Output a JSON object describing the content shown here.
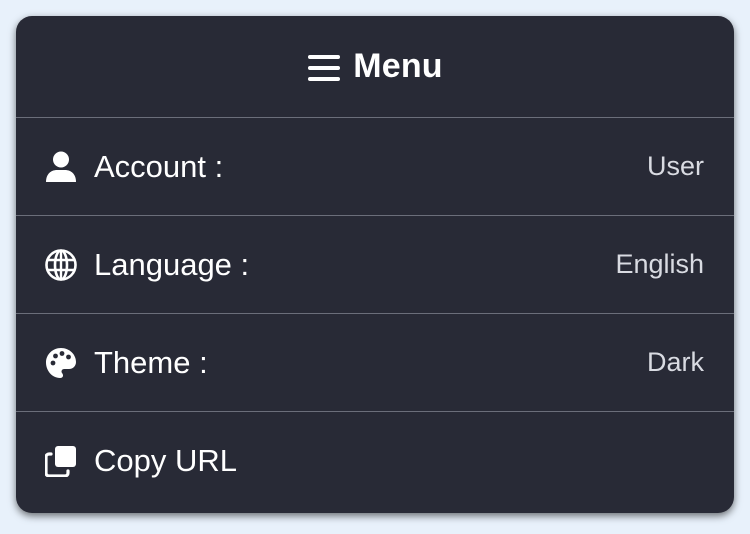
{
  "menu": {
    "title": "Menu",
    "header_icon": "hamburger-icon",
    "items": [
      {
        "icon": "user-icon",
        "label": "Account :",
        "value": "User"
      },
      {
        "icon": "globe-icon",
        "label": "Language :",
        "value": "English"
      },
      {
        "icon": "palette-icon",
        "label": "Theme :",
        "value": "Dark"
      },
      {
        "icon": "copy-icon",
        "label": "Copy URL"
      }
    ]
  },
  "colors": {
    "page_background": "#e8f1fb",
    "panel_background": "#282a36",
    "divider": "#6b6e7a",
    "text": "#ffffff",
    "value_text": "#d9dbe2"
  }
}
